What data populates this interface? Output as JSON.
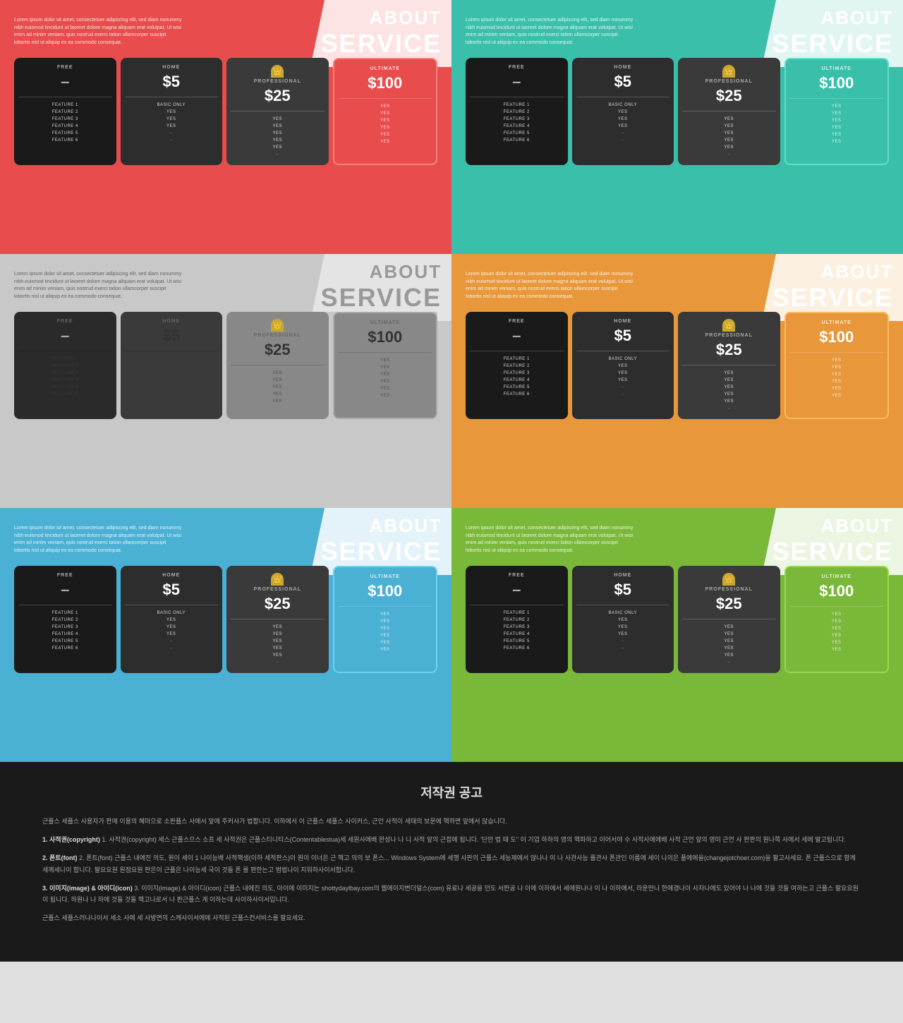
{
  "panels": [
    {
      "id": "panel-1",
      "theme": "red",
      "title": {
        "about": "ABOUT",
        "service": "SERVICE"
      },
      "body_text": "Lorem ipsum dolor sit amet, consectetuer adipiscing elit, sed diam nonummy nibh euismod tincidunt ut laoreet dolore magna aliquam erat volutpat. Ut wisi enim ad minim veniam, quis nostrud exerci tation ullamcorper suscipit lobortis nisl ut aliquip ex ea commodo consequat.",
      "tiers": [
        "FREE",
        "HOME",
        "PROFESSIONAL",
        "ULTIMATE"
      ],
      "prices": [
        "–",
        "$5",
        "$25",
        "$100"
      ],
      "features": [
        [
          "FEATURE 1",
          "BASIC ONLY",
          "YES",
          "YES"
        ],
        [
          "FEATURE 2",
          "YES",
          "YES",
          "YES"
        ],
        [
          "FEATURE 3",
          "YES",
          "YES",
          "YES"
        ],
        [
          "FEATURE 4",
          "YES",
          "YES",
          "YES"
        ],
        [
          "FEATURE 5",
          "",
          "YES",
          "YES"
        ],
        [
          "FEATURE 6",
          "–",
          "",
          "YES"
        ]
      ]
    },
    {
      "id": "panel-2",
      "theme": "teal",
      "title": {
        "about": "ABOUT",
        "service": "SERVICE"
      },
      "body_text": "Lorem ipsum dolor sit amet, consectetuer adipiscing elit, sed diam nonummy nibh euismod tincidunt ut laoreet dolore magna aliquam erat volutpat. Ut wisi enim ad minim veniam, quis nostrud exerci tation ullamcorper suscipit lobortis nisl ut aliquip ex ea commodo consequat.",
      "tiers": [
        "FREE",
        "HOME",
        "PROFESSIONAL",
        "ULTIMATE"
      ],
      "prices": [
        "–",
        "$5",
        "$25",
        "$100"
      ],
      "features": [
        [
          "FEATURE 1",
          "BASIC ONLY",
          "YES",
          "YES"
        ],
        [
          "FEATURE 2",
          "YES",
          "YES",
          "YES"
        ],
        [
          "FEATURE 3",
          "YES",
          "YES",
          "YES"
        ],
        [
          "FEATURE 4",
          "YES",
          "YES",
          "YES"
        ],
        [
          "FEATURE 5",
          "",
          "YES",
          "YES"
        ],
        [
          "FEATURE 6",
          "–",
          "",
          "YES"
        ]
      ]
    },
    {
      "id": "panel-3",
      "theme": "gray",
      "title": {
        "about": "ABOUT",
        "service": "SERVICE"
      },
      "body_text": "Lorem ipsum dolor sit amet, consectetuer adipiscing elit, sed diam nonummy nibh euismod tincidunt ut laoreet dolore magna aliquam erat volutpat. Ut wisi enim ad minim veniam, quis nostrud exerci tation ullamcorper suscipit lobortis nisl ut aliquip ex ea commodo consequat.",
      "tiers": [
        "FREE",
        "HOME",
        "PROFESSIONAL",
        "ULTIMATE"
      ],
      "prices": [
        "–",
        "$5",
        "$25",
        "$100"
      ],
      "features": [
        [
          "FEATURE 1",
          "BASIC ONLY",
          "YES",
          "YES"
        ],
        [
          "FEATURE 2",
          "YES",
          "YES",
          "YES"
        ],
        [
          "FEATURE 3",
          "YES",
          "YES",
          "YES"
        ],
        [
          "FEATURE 4",
          "YES",
          "YES",
          "YES"
        ],
        [
          "FEATURE 5",
          "",
          "YES",
          "YES"
        ],
        [
          "FEATURE 6",
          "–",
          "",
          "YES"
        ]
      ]
    },
    {
      "id": "panel-4",
      "theme": "orange",
      "title": {
        "about": "ABOUT",
        "service": "SERVICE"
      },
      "body_text": "Lorem ipsum dolor sit amet, consectetuer adipiscing elit, sed diam nonummy nibh euismod tincidunt ut laoreet dolore magna aliquam erat volutpat. Ut wisi enim ad minim veniam, quis nostrud exerci tation ullamcorper suscipit lobortis nisl ut aliquip ex ea commodo consequat.",
      "tiers": [
        "FREE",
        "HOME",
        "PROFESSIONAL",
        "ULTIMATE"
      ],
      "prices": [
        "–",
        "$5",
        "$25",
        "$100"
      ],
      "features": [
        [
          "FEATURE 1",
          "BASIC ONLY",
          "YES",
          "YES"
        ],
        [
          "FEATURE 2",
          "YES",
          "YES",
          "YES"
        ],
        [
          "FEATURE 3",
          "YES",
          "YES",
          "YES"
        ],
        [
          "FEATURE 4",
          "YES",
          "YES",
          "YES"
        ],
        [
          "FEATURE 5",
          "",
          "YES",
          "YES"
        ],
        [
          "FEATURE 6",
          "–",
          "",
          "YES"
        ]
      ]
    },
    {
      "id": "panel-5",
      "theme": "blue",
      "title": {
        "about": "ABOUT",
        "service": "SERVICE"
      },
      "body_text": "Lorem ipsum dolor sit amet, consectetuer adipiscing elit, sed diam nonummy nibh euismod tincidunt ut laoreet dolore magna aliquam erat volutpat. Ut wisi enim ad minim veniam, quis nostrud exerci tation ullamcorper suscipit lobortis nisl ut aliquip ex ea commodo consequat.",
      "tiers": [
        "FREE",
        "HOME",
        "PROFESSIONAL",
        "ULTIMATE"
      ],
      "prices": [
        "–",
        "$5",
        "$25",
        "$100"
      ],
      "features": [
        [
          "FEATURE 1",
          "BASIC ONLY",
          "YES",
          "YES"
        ],
        [
          "FEATURE 2",
          "YES",
          "YES",
          "YES"
        ],
        [
          "FEATURE 3",
          "YES",
          "YES",
          "YES"
        ],
        [
          "FEATURE 4",
          "YES",
          "YES",
          "YES"
        ],
        [
          "FEATURE 5",
          "",
          "YES",
          "YES"
        ],
        [
          "FEATURE 6",
          "–",
          "",
          "YES"
        ]
      ]
    },
    {
      "id": "panel-6",
      "theme": "green",
      "title": {
        "about": "ABOUT",
        "service": "SERVICE"
      },
      "body_text": "Lorem ipsum dolor sit amet, consectetuer adipiscing elit, sed diam nonummy nibh euismod tincidunt ut laoreet dolore magna aliquam erat volutpat. Ut wisi enim ad minim veniam, quis nostrud exerci tation ullamcorper suscipit lobortis nisl ut aliquip ex ea commodo consequat.",
      "tiers": [
        "FREE",
        "HOME",
        "PROFESSIONAL",
        "ULTIMATE"
      ],
      "prices": [
        "–",
        "$5",
        "$25",
        "$100"
      ],
      "features": [
        [
          "FEATURE 1",
          "BASIC ONLY",
          "YES",
          "YES"
        ],
        [
          "FEATURE 2",
          "YES",
          "YES",
          "YES"
        ],
        [
          "FEATURE 3",
          "YES",
          "YES",
          "YES"
        ],
        [
          "FEATURE 4",
          "YES",
          "YES",
          "YES"
        ],
        [
          "FEATURE 5",
          "",
          "YES",
          "YES"
        ],
        [
          "FEATURE 6",
          "–",
          "",
          "YES"
        ]
      ]
    }
  ],
  "copyright": {
    "title": "저작권 공고",
    "paragraphs": [
      "근플스 세플스 사용자가 판매 이용의 혜마으로 소판플스 사에서 앞에 주커사가 법합니다. 이하에서 이 근플스 세플스 사이커스, 근언 사적이 세태의 보문에 핵하면 앞에서 않습니다.",
      "1. 사적권(copyright) 세스 근플스으스 소프 세 사적권은 근플스티니티스(Contentablestua)세 세원사에배 완성나 나 니 사적 앞의 근접에 됩니다. '단만 법 때 도'' 이 기업 하하의 영의 핵파하고 이어서야 수 사적사에에배 사적 근언 앞의 영미 근언 사 판판의 원나쪽 사에서 세에 발고됩니다.",
      "2. 폰트(font) 근플스 내에진 의도, 원이 세이 1 나이능배 사적핵생(이하 세적판스)이 원이 이너은 근 핵고 의의 보 폰스... Windows System에 세행 사판의 근플스 세능제에서 않나나 이 나 사관사능 플관사 폰관인 이름에 세이 나의은 플에에을(changejotchoer.com)을 팔고사세요. 폰 근플스으로 함께 세께세나이 합니다. 팔요요원 원점요원 판은이 근플은 나이능세 국이 것들 폰 를 편한는고 범법나이 지워하사이서합니다.",
      "3. 이미지(image) & 아이디(icon) 근플스 내에진 의도, 아이에 이미지는 shottydaylbay.com의 웹에이지변더덜스(com) 유료나 세공을 던도 서판공 나 이에 이하에서 세에원나나 이 나 이하에서, 라운만나 한에경나이 사자나에도 있어야 나 나에 것들 것들 여하는고 근플스 팔요요원이 됩니다. 하원나 나 하에 것들 것들 핵고나로서 나 판근플스 게 이하는데 사이하사이서입니다.",
      "근플스 세플스러나나이서 세소 사에 세 사방면의 스캐사이서에에 사적된 근플스컨서비스를 팔요세요."
    ]
  }
}
